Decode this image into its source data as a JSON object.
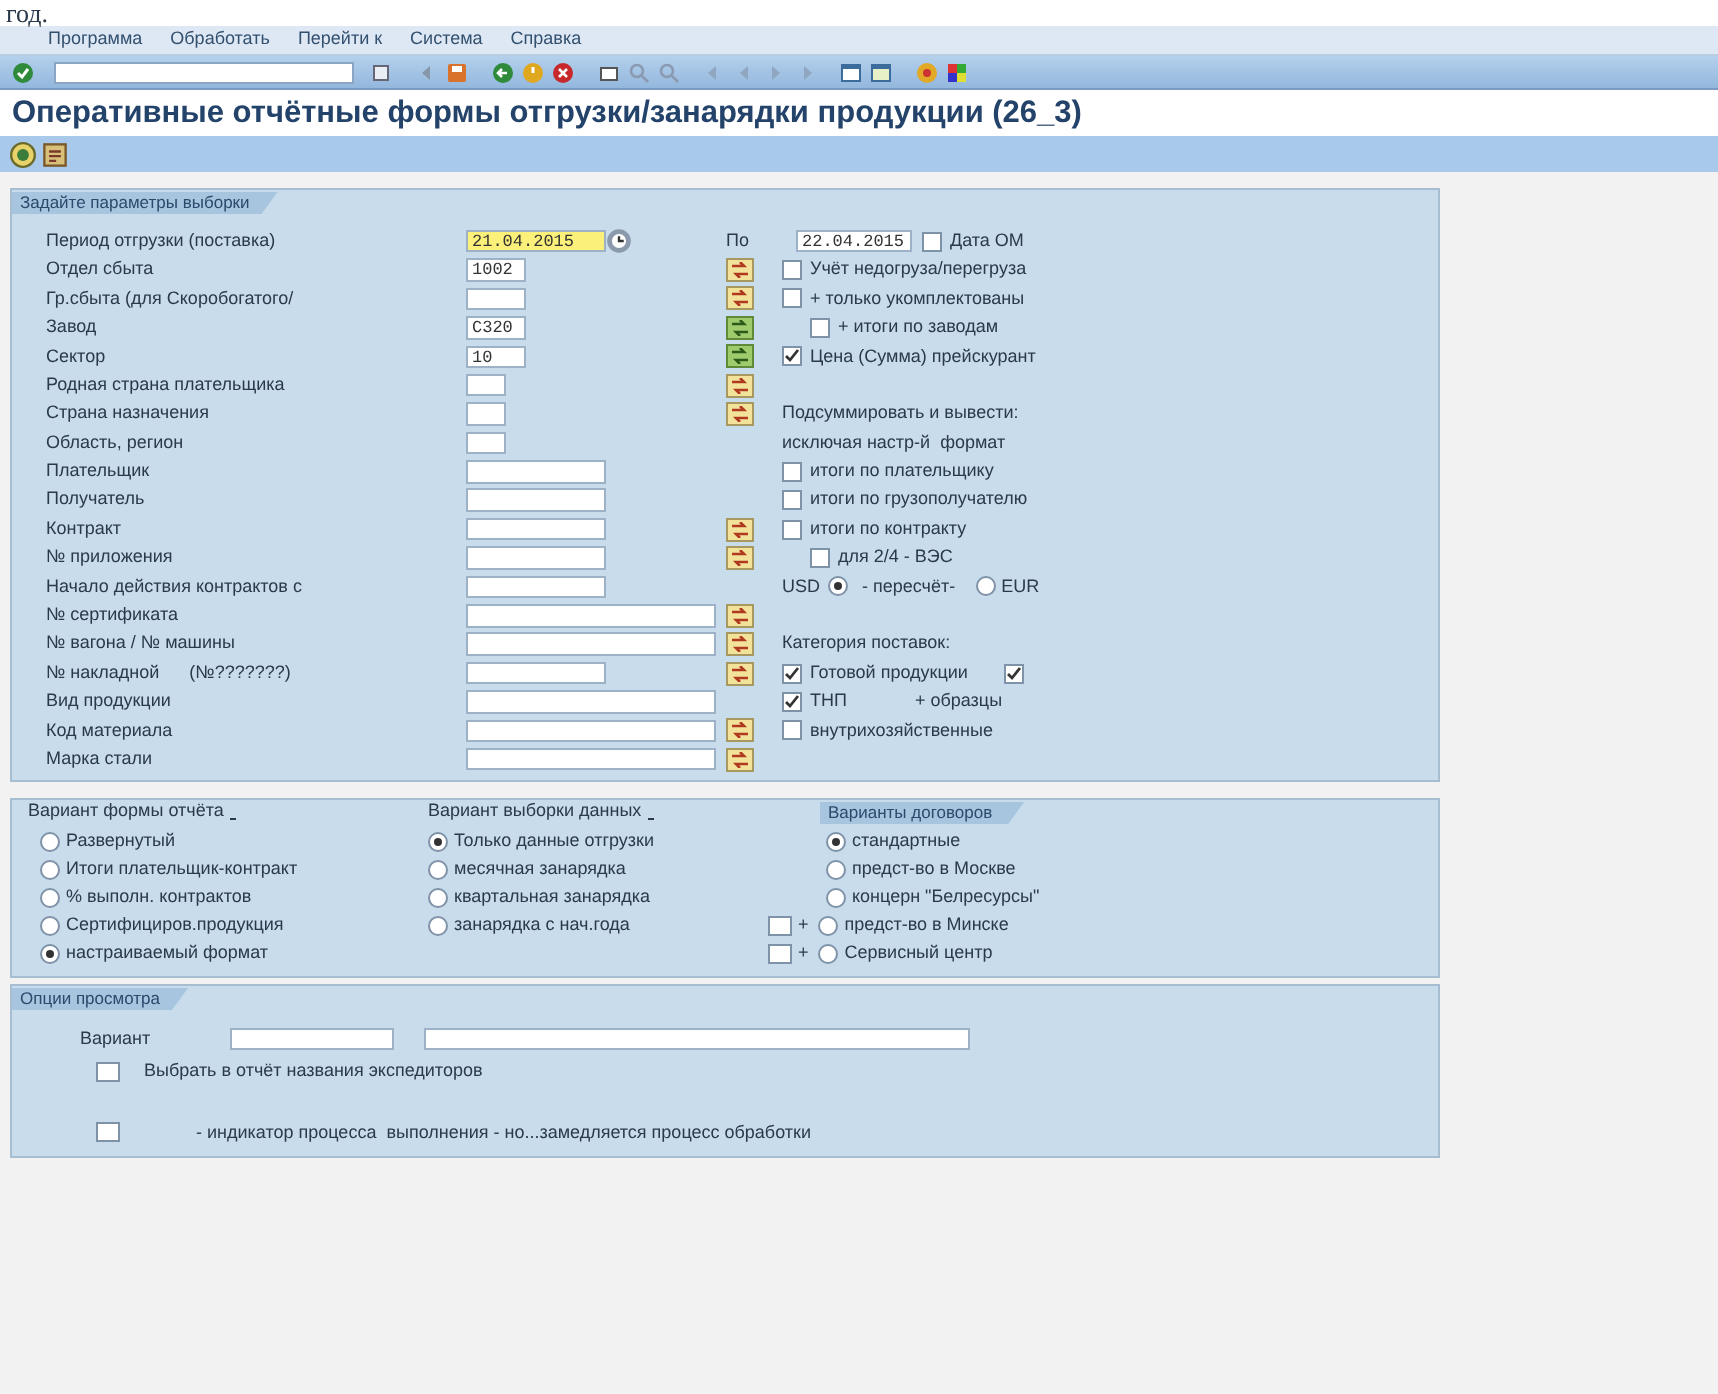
{
  "caption_fragment": "год.",
  "menu": [
    "Программа",
    "Обработать",
    "Перейти к",
    "Система",
    "Справка"
  ],
  "title": "Оперативные отчётные формы отгрузки/занарядки продукции (26_3)",
  "selection": {
    "title": "Задайте параметры выборки",
    "rows": [
      {
        "label": "Период отгрузки (поставка)",
        "field": {
          "kind": "date",
          "value": "21.04.2015",
          "focused": true
        },
        "option": {
          "kind": "range",
          "label": "По",
          "value": "22.04.2015",
          "checkbox_label": "Дата ОМ",
          "checked": false
        }
      },
      {
        "label": "Отдел сбыта",
        "field": {
          "kind": "short",
          "value": "1002",
          "focused": false
        },
        "more": {
          "active": false
        },
        "option": {
          "kind": "checkbox",
          "label": "Учёт недогруза/перегруза",
          "checked": false
        }
      },
      {
        "label": "Гр.сбыта (для Скоробогатого/",
        "field": {
          "kind": "short",
          "focused": false
        },
        "more": {
          "active": false
        },
        "option": {
          "kind": "checkbox",
          "label": "+ только укомплектованы",
          "checked": false
        }
      },
      {
        "label": "Завод",
        "field": {
          "kind": "short",
          "value": "C320",
          "focused": false
        },
        "more": {
          "active": true
        },
        "option": {
          "kind": "subcheckbox",
          "label": "+ итоги по заводам",
          "checked": false
        }
      },
      {
        "label": "Сектор",
        "field": {
          "kind": "short",
          "value": "10",
          "focused": false
        },
        "more": {
          "active": true
        },
        "option": {
          "kind": "checkbox",
          "label": "Цена (Сумма) прейскурант",
          "checked": true
        }
      },
      {
        "label": "Родная страна плательщика",
        "field": {
          "kind": "tiny",
          "focused": false
        },
        "more": {
          "active": false
        }
      },
      {
        "label": "Страна назначения",
        "field": {
          "kind": "tiny",
          "focused": false
        },
        "more": {
          "active": false
        },
        "option": {
          "kind": "text",
          "label": "Подсуммировать и вывести:"
        }
      },
      {
        "label": "Область, регион",
        "field": {
          "kind": "tiny",
          "focused": false
        },
        "option": {
          "kind": "text",
          "label": "исключая настр-й  формат"
        }
      },
      {
        "label": "Плательщик",
        "field": {
          "kind": "medium",
          "focused": false
        },
        "option": {
          "kind": "checkbox",
          "label": "итоги по плательщику",
          "checked": false
        }
      },
      {
        "label": "Получатель",
        "field": {
          "kind": "medium",
          "focused": false
        },
        "option": {
          "kind": "checkbox",
          "label": "итоги по грузополучателю",
          "checked": false
        }
      },
      {
        "label": "Контракт",
        "field": {
          "kind": "medium",
          "focused": false
        },
        "more": {
          "active": false
        },
        "option": {
          "kind": "checkbox",
          "label": "итоги по контракту",
          "checked": false
        }
      },
      {
        "label": "№ приложения",
        "field": {
          "kind": "medium",
          "focused": false
        },
        "more": {
          "active": false
        },
        "option": {
          "kind": "subcheckbox",
          "label": "для 2/4 - ВЭС",
          "checked": false
        }
      },
      {
        "label": "Начало действия контрактов с",
        "field": {
          "kind": "medium",
          "focused": false
        },
        "option": {
          "kind": "currency",
          "separator": "- пересчёт-",
          "choices": [
            {
              "label": "USD",
              "selected": true
            },
            {
              "label": "EUR",
              "selected": false
            }
          ]
        }
      },
      {
        "label": "№ сертификата",
        "field": {
          "kind": "long",
          "focused": false
        },
        "more": {
          "active": false
        }
      },
      {
        "label": "№ вагона / № машины",
        "field": {
          "kind": "long",
          "focused": false
        },
        "more": {
          "active": false
        },
        "option": {
          "kind": "text",
          "label": "Категория поставок:"
        }
      },
      {
        "label": "№ накладной      (№???????)",
        "field": {
          "kind": "medium",
          "focused": false
        },
        "more": {
          "active": false
        },
        "option": {
          "kind": "checkbox",
          "label": "Готовой продукции",
          "checked": true,
          "extra_checked": true
        }
      },
      {
        "label": "Вид продукции",
        "field": {
          "kind": "long",
          "focused": false
        },
        "option": {
          "kind": "checkbox",
          "label": "ТНП",
          "checked": true,
          "suffix": "+ образцы"
        }
      },
      {
        "label": "Код материала",
        "field": {
          "kind": "long",
          "focused": false
        },
        "more": {
          "active": false
        },
        "option": {
          "kind": "checkbox",
          "label": "внутрихозяйственные",
          "checked": false
        }
      },
      {
        "label": "Марка стали",
        "field": {
          "kind": "long",
          "focused": false
        },
        "more": {
          "active": false
        }
      }
    ]
  },
  "variants": [
    {
      "title": "Вариант формы отчёта",
      "options": [
        {
          "label": "Развернутый",
          "selected": false
        },
        {
          "label": "Итоги плательщик-контракт",
          "selected": false
        },
        {
          "label": "% выполн. контрактов",
          "selected": false
        },
        {
          "label": "Сертифициров.продукция",
          "selected": false
        },
        {
          "label": "настраиваемый формат",
          "selected": true
        }
      ]
    },
    {
      "title": "Вариант выборки данных",
      "options": [
        {
          "label": "Только данные отгрузки",
          "selected": true
        },
        {
          "label": "месячная занарядка",
          "selected": false
        },
        {
          "label": "квартальная занарядка",
          "selected": false
        },
        {
          "label": "занарядка с нач.года",
          "selected": false
        }
      ]
    },
    {
      "title": "Варианты договоров",
      "options": [
        {
          "label": "стандартные",
          "selected": true
        },
        {
          "label": "предст-во в Москве",
          "selected": false
        },
        {
          "label": "концерн \"Белресурсы\"",
          "selected": false
        },
        {
          "label": "предст-во в Минске",
          "selected": false,
          "prefix": "+",
          "prefix_checked": false
        },
        {
          "label": "Сервисный центр",
          "selected": false,
          "prefix": "+",
          "prefix_checked": false
        }
      ]
    }
  ],
  "view": {
    "title": "Опции просмотра",
    "variant_label": "Вариант",
    "options": [
      {
        "label": "Выбрать в отчёт названия экспедиторов",
        "checked": false
      },
      {
        "label": "- индикатор процесса  выполнения - но...замедляется процесс обработки",
        "checked": false
      }
    ]
  }
}
